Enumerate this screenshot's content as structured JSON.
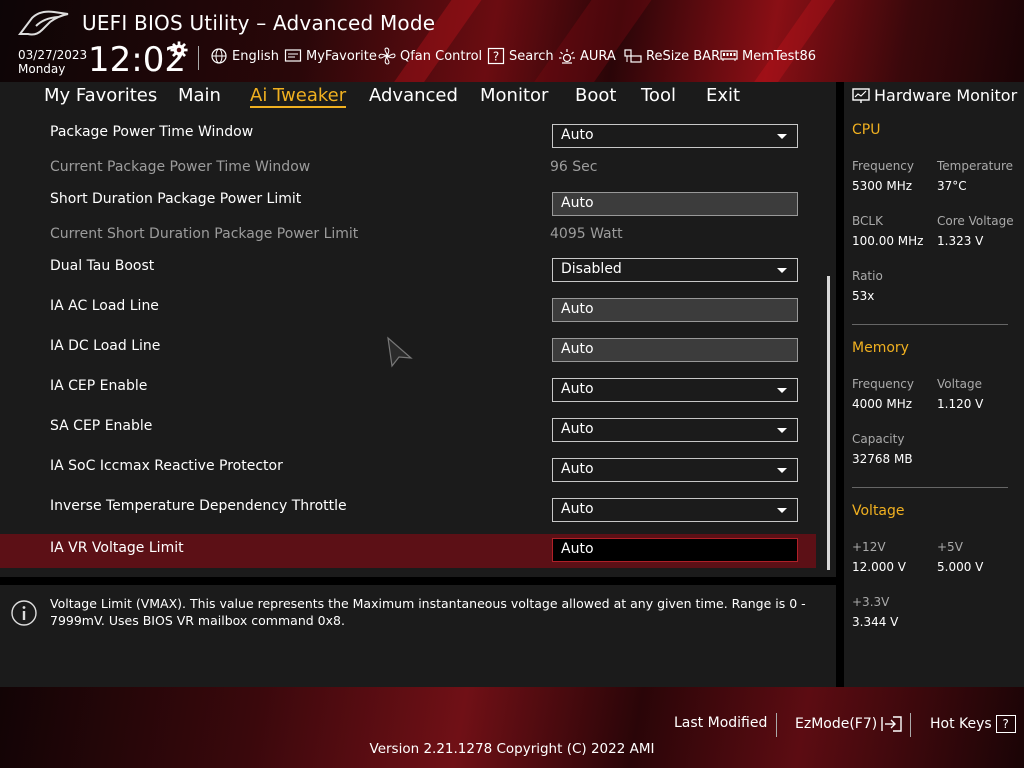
{
  "header": {
    "title": "UEFI BIOS Utility – Advanced Mode",
    "date": "03/27/2023",
    "day": "Monday",
    "time": "12:02",
    "toolbar": [
      {
        "label": "English",
        "icon": "globe-icon"
      },
      {
        "label": "MyFavorite",
        "icon": "favorite-icon"
      },
      {
        "label": "Qfan Control",
        "icon": "fan-icon"
      },
      {
        "label": "Search",
        "icon": "search-icon"
      },
      {
        "label": "AURA",
        "icon": "aura-icon"
      },
      {
        "label": "ReSize BAR",
        "icon": "resize-bar-icon"
      },
      {
        "label": "MemTest86",
        "icon": "memtest-icon"
      }
    ]
  },
  "nav": {
    "tabs": [
      "My Favorites",
      "Main",
      "Ai Tweaker",
      "Advanced",
      "Monitor",
      "Boot",
      "Tool",
      "Exit"
    ],
    "active": "Ai Tweaker"
  },
  "settings": [
    {
      "label": "Package Power Time Window",
      "type": "dropdown",
      "value": "Auto"
    },
    {
      "label": "Current Package Power Time Window",
      "type": "readonly",
      "value": "96 Sec"
    },
    {
      "label": "Short Duration Package Power Limit",
      "type": "text",
      "value": "Auto"
    },
    {
      "label": "Current Short Duration Package Power Limit",
      "type": "readonly",
      "value": "4095 Watt"
    },
    {
      "label": "Dual Tau Boost",
      "type": "dropdown",
      "value": "Disabled"
    },
    {
      "label": "IA AC Load Line",
      "type": "text",
      "value": "Auto"
    },
    {
      "label": "IA DC Load Line",
      "type": "text",
      "value": "Auto"
    },
    {
      "label": "IA CEP Enable",
      "type": "dropdown",
      "value": "Auto"
    },
    {
      "label": "SA CEP Enable",
      "type": "dropdown",
      "value": "Auto"
    },
    {
      "label": "IA SoC Iccmax Reactive Protector",
      "type": "dropdown",
      "value": "Auto"
    },
    {
      "label": "Inverse Temperature Dependency Throttle",
      "type": "dropdown",
      "value": "Auto"
    },
    {
      "label": "IA VR Voltage Limit",
      "type": "text",
      "value": "Auto",
      "selected": true
    }
  ],
  "help": {
    "text": "Voltage Limit (VMAX). This value represents the Maximum instantaneous voltage allowed at any given time. Range is 0 - 7999mV. Uses BIOS VR mailbox command 0x8."
  },
  "hardware_monitor": {
    "title": "Hardware Monitor",
    "cpu": {
      "heading": "CPU",
      "frequency_label": "Frequency",
      "frequency": "5300 MHz",
      "temperature_label": "Temperature",
      "temperature": "37°C",
      "bclk_label": "BCLK",
      "bclk": "100.00 MHz",
      "core_voltage_label": "Core Voltage",
      "core_voltage": "1.323 V",
      "ratio_label": "Ratio",
      "ratio": "53x"
    },
    "memory": {
      "heading": "Memory",
      "frequency_label": "Frequency",
      "frequency": "4000 MHz",
      "voltage_label": "Voltage",
      "voltage": "1.120 V",
      "capacity_label": "Capacity",
      "capacity": "32768 MB"
    },
    "voltage": {
      "heading": "Voltage",
      "v12_label": "+12V",
      "v12": "12.000 V",
      "v5_label": "+5V",
      "v5": "5.000 V",
      "v33_label": "+3.3V",
      "v33": "3.344 V"
    }
  },
  "footer": {
    "last_modified": "Last Modified",
    "ezmode": "EzMode(F7)",
    "hotkeys": "Hot Keys",
    "hotkeys_key": "?",
    "version": "Version 2.21.1278 Copyright (C) 2022 AMI"
  },
  "colors": {
    "accent": "#f0b020",
    "selected_row": "#5c1016",
    "panel": "#1b1b1b"
  }
}
